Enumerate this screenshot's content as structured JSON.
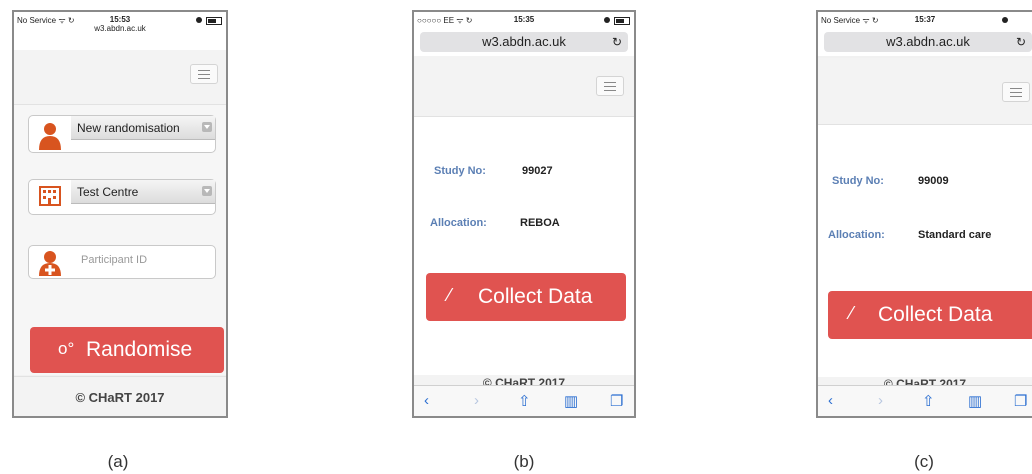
{
  "captions": [
    "(a)",
    "(b)",
    "(c)"
  ],
  "screen_a": {
    "status": {
      "carrier": "No Service ᯤ ↻",
      "time": "15:53",
      "url": "w3.abdn.ac.uk"
    },
    "menu_icon": "hamburger-icon",
    "randomisation_select": {
      "icon": "person-icon",
      "value": "New randomisation"
    },
    "centre_select": {
      "icon": "building-icon",
      "value": "Test Centre"
    },
    "participant_field": {
      "icon": "person-add-icon",
      "placeholder": "Participant ID"
    },
    "randomise_button": {
      "icon": "gears-icon",
      "label": "Randomise"
    },
    "footer": "© CHaRT 2017"
  },
  "screen_b": {
    "status": {
      "carrier": "○○○○○ EE ᯤ ↻",
      "time": "15:35"
    },
    "url": "w3.abdn.ac.uk",
    "study_label": "Study No:",
    "study_value": "99027",
    "allocation_label": "Allocation:",
    "allocation_value": "REBOA",
    "collect_button": {
      "icon": "pencil-icon",
      "label": "Collect Data"
    },
    "footer": "© CHaRT 2017",
    "toolbar": [
      "back-icon",
      "forward-icon",
      "share-icon",
      "bookmarks-icon",
      "tabs-icon"
    ]
  },
  "screen_c": {
    "status": {
      "carrier": "No Service ᯤ ↻",
      "time": "15:37"
    },
    "url": "w3.abdn.ac.uk",
    "study_label": "Study No:",
    "study_value": "99009",
    "allocation_label": "Allocation:",
    "allocation_value": "Standard care",
    "collect_button": {
      "icon": "pencil-icon",
      "label": "Collect Data"
    },
    "footer": "© CHaRT 2017",
    "toolbar": [
      "back-icon",
      "forward-icon",
      "share-icon",
      "bookmarks-icon",
      "tabs-icon"
    ]
  }
}
